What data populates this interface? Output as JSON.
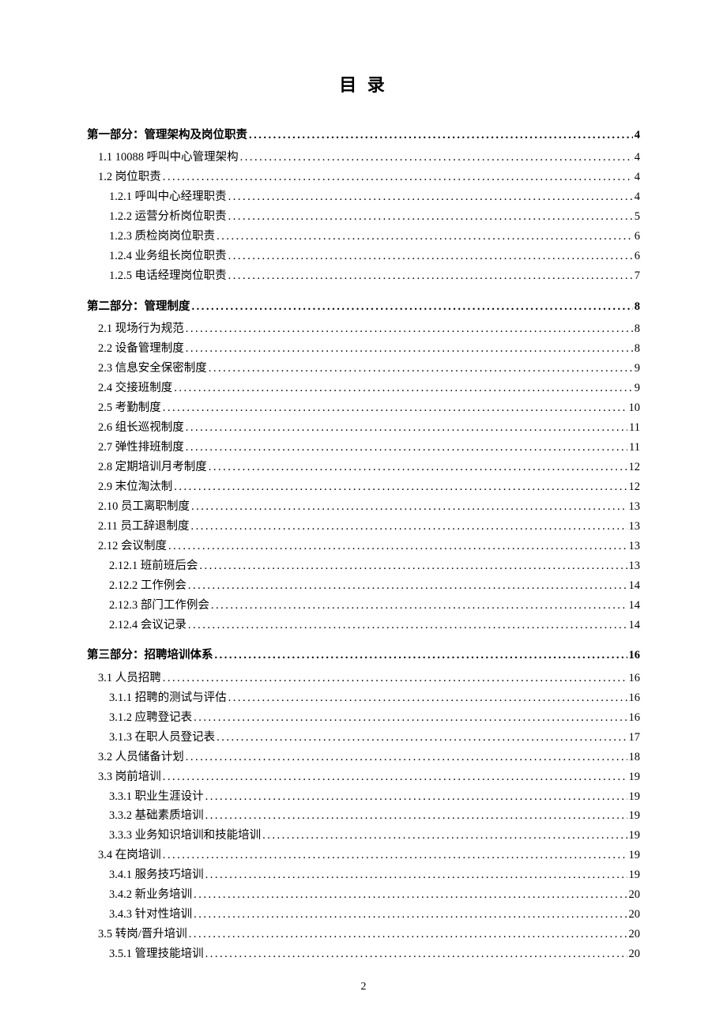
{
  "title": "目 录",
  "pageNumber": "2",
  "entries": [
    {
      "level": "part",
      "label": "第一部分：管理架构及岗位职责",
      "page": "4"
    },
    {
      "level": "level1",
      "label": "1.1 10088 呼叫中心管理架构",
      "page": "4"
    },
    {
      "level": "level1",
      "label": "1.2 岗位职责",
      "page": "4"
    },
    {
      "level": "level2",
      "label": "1.2.1 呼叫中心经理职责",
      "page": "4"
    },
    {
      "level": "level2",
      "label": "1.2.2 运营分析岗位职责",
      "page": "5"
    },
    {
      "level": "level2",
      "label": "1.2.3 质检岗岗位职责",
      "page": "6"
    },
    {
      "level": "level2",
      "label": "1.2.4 业务组长岗位职责",
      "page": "6"
    },
    {
      "level": "level2",
      "label": "1.2.5 电话经理岗位职责",
      "page": "7"
    },
    {
      "level": "part",
      "label": "第二部分：管理制度",
      "page": "8"
    },
    {
      "level": "level1",
      "label": "2.1 现场行为规范",
      "page": "8"
    },
    {
      "level": "level1",
      "label": "2.2 设备管理制度",
      "page": "8"
    },
    {
      "level": "level1",
      "label": "2.3 信息安全保密制度",
      "page": "9"
    },
    {
      "level": "level1",
      "label": "2.4 交接班制度",
      "page": "9"
    },
    {
      "level": "level1",
      "label": "2.5 考勤制度",
      "page": "10"
    },
    {
      "level": "level1",
      "label": "2.6 组长巡视制度",
      "page": "11"
    },
    {
      "level": "level1",
      "label": "2.7 弹性排班制度",
      "page": "11"
    },
    {
      "level": "level1",
      "label": "2.8 定期培训月考制度",
      "page": "12"
    },
    {
      "level": "level1",
      "label": "2.9 末位淘汰制",
      "page": "12"
    },
    {
      "level": "level1",
      "label": "2.10 员工离职制度",
      "page": "13"
    },
    {
      "level": "level1",
      "label": "2.11 员工辞退制度",
      "page": "13"
    },
    {
      "level": "level1",
      "label": "2.12 会议制度",
      "page": "13"
    },
    {
      "level": "level2",
      "label": "2.12.1 班前班后会",
      "page": "13"
    },
    {
      "level": "level2",
      "label": "2.12.2 工作例会",
      "page": "14"
    },
    {
      "level": "level2",
      "label": "2.12.3 部门工作例会",
      "page": "14"
    },
    {
      "level": "level2",
      "label": "2.12.4 会议记录",
      "page": "14"
    },
    {
      "level": "part",
      "label": "第三部分：招聘培训体系",
      "page": "16"
    },
    {
      "level": "level1",
      "label": "3.1 人员招聘",
      "page": "16"
    },
    {
      "level": "level2",
      "label": "3.1.1 招聘的测试与评估",
      "page": "16"
    },
    {
      "level": "level2",
      "label": "3.1.2 应聘登记表",
      "page": "16"
    },
    {
      "level": "level2",
      "label": "3.1.3 在职人员登记表",
      "page": "17"
    },
    {
      "level": "level1",
      "label": "3.2 人员储备计划",
      "page": "18"
    },
    {
      "level": "level1",
      "label": "3.3 岗前培训",
      "page": "19"
    },
    {
      "level": "level2",
      "label": "3.3.1 职业生涯设计",
      "page": "19"
    },
    {
      "level": "level2",
      "label": "3.3.2 基础素质培训",
      "page": "19"
    },
    {
      "level": "level2",
      "label": "3.3.3 业务知识培训和技能培训",
      "page": "19"
    },
    {
      "level": "level1",
      "label": "3.4 在岗培训",
      "page": "19"
    },
    {
      "level": "level2",
      "label": "3.4.1 服务技巧培训",
      "page": "19"
    },
    {
      "level": "level2",
      "label": "3.4.2 新业务培训",
      "page": "20"
    },
    {
      "level": "level2",
      "label": "3.4.3  针对性培训",
      "page": "20"
    },
    {
      "level": "level1",
      "label": "3.5 转岗/晋升培训",
      "page": "20"
    },
    {
      "level": "level2",
      "label": "3.5.1 管理技能培训",
      "page": "20"
    }
  ]
}
